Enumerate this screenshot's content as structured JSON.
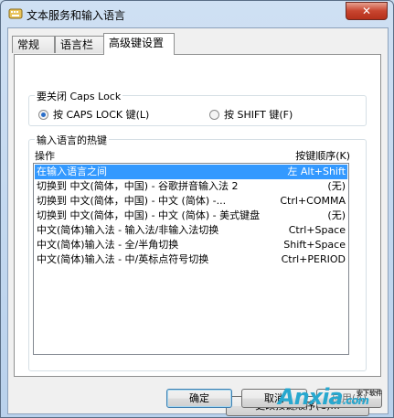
{
  "window": {
    "title": "文本服务和输入语言",
    "close_glyph": "✕"
  },
  "tabs": [
    {
      "label": "常规"
    },
    {
      "label": "语言栏"
    },
    {
      "label": "高级键设置"
    }
  ],
  "caps_lock": {
    "label": "要关闭 Caps Lock",
    "options": [
      {
        "label": "按 CAPS LOCK 键(L)",
        "checked": true
      },
      {
        "label": "按 SHIFT 键(F)",
        "checked": false
      }
    ]
  },
  "hotkeys": {
    "label": "输入语言的热键",
    "col_action": "操作",
    "col_key": "按键顺序(K)",
    "rows": [
      {
        "action": "在输入语言之间",
        "key": "左 Alt+Shift",
        "selected": true
      },
      {
        "action": "切换到 中文(简体，中国) - 谷歌拼音输入法 2",
        "key": "(无)"
      },
      {
        "action": "切换到 中文(简体，中国) - 中文 (简体) -...",
        "key": "Ctrl+COMMA"
      },
      {
        "action": "切换到 中文(简体，中国) - 中文 (简体) - 美式键盘",
        "key": "(无)"
      },
      {
        "action": "中文(简体)输入法 - 输入法/非输入法切换",
        "key": "Ctrl+Space"
      },
      {
        "action": "中文(简体)输入法 - 全/半角切换",
        "key": "Shift+Space"
      },
      {
        "action": "中文(简体)输入法 - 中/英标点符号切换",
        "key": "Ctrl+PERIOD"
      }
    ],
    "change_button": "更改按键顺序(C)..."
  },
  "footer": {
    "ok": "确定",
    "cancel": "取消",
    "apply": "应用(A)"
  },
  "watermark": {
    "text": "Anxia",
    "suffix": ".com",
    "sub": "安下软件"
  }
}
